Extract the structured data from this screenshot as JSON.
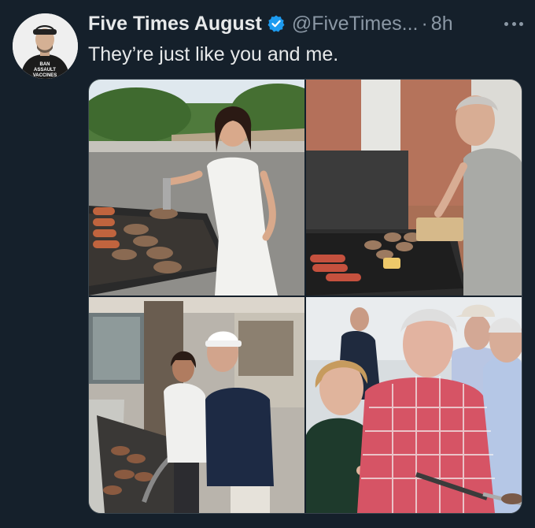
{
  "tweet": {
    "display_name": "Five Times August",
    "handle": "@FiveTimes...",
    "separator": "·",
    "time": "8h",
    "text": "They’re just like you and me.",
    "verified_color": "#1d9bf0"
  },
  "avatar": {
    "shirt_text": [
      "BAN",
      "ASSAULT",
      "VACCINES"
    ]
  },
  "media": {
    "photos": [
      {
        "name": "photo-woman-grilling-burgers"
      },
      {
        "name": "photo-man-grilling-sausages"
      },
      {
        "name": "photo-couple-at-grill"
      },
      {
        "name": "photo-couple-grilling-outdoors"
      }
    ]
  },
  "icons": {
    "verified": "verified-badge-icon",
    "more": "more-options-icon"
  }
}
